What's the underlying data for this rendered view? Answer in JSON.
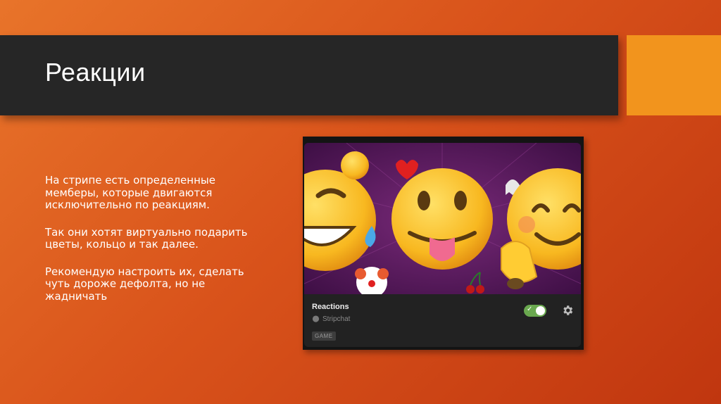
{
  "slide": {
    "title": "Реакции",
    "paragraphs": [
      "На стрипе есть определенные мемберы, которые двигаются исключительно по реакциям.",
      "Так они хотят виртуально подарить цветы, кольцо и так далее.",
      "Рекомендую настроить их, сделать чуть дороже дефолта, но не жадничать"
    ]
  },
  "app_card": {
    "name": "Reactions",
    "publisher": "Stripchat",
    "tag": "GAME",
    "enabled": true,
    "icons": {
      "toggle": "toggle-on",
      "settings": "gear-icon",
      "publisher": "chat-bubble-icon"
    }
  },
  "colors": {
    "title_bar": "#262626",
    "accent": "#f2941d",
    "toggle_on": "#6aa84f",
    "art_background": "#5a1a5e"
  }
}
